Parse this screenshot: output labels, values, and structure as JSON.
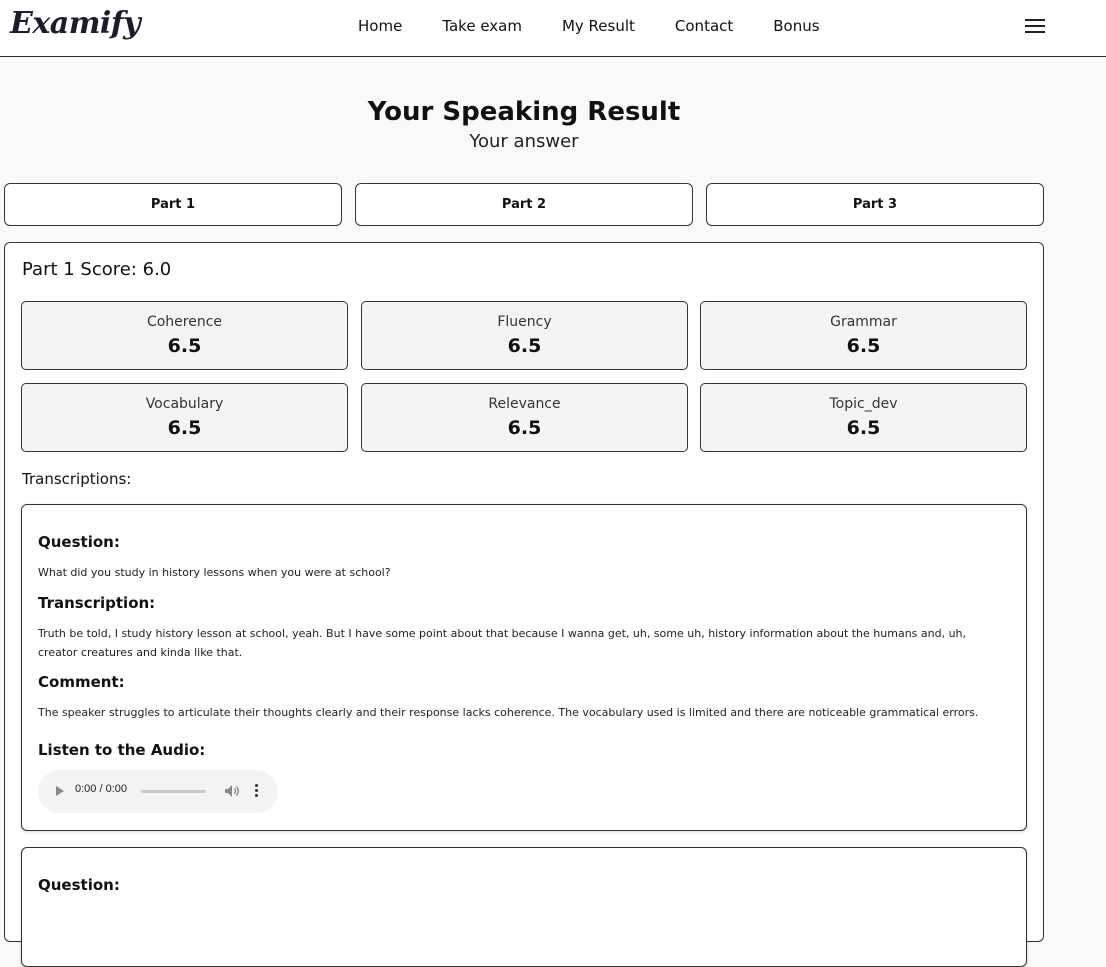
{
  "nav": {
    "logo": "Examify",
    "links": [
      "Home",
      "Take exam",
      "My Result",
      "Contact",
      "Bonus"
    ]
  },
  "header": {
    "title": "Your Speaking Result",
    "subtitle": "Your answer"
  },
  "tabs": [
    "Part 1",
    "Part 2",
    "Part 3"
  ],
  "result": {
    "score_title": "Part 1 Score: 6.0",
    "metrics": [
      {
        "label": "Coherence",
        "value": "6.5"
      },
      {
        "label": "Fluency",
        "value": "6.5"
      },
      {
        "label": "Grammar",
        "value": "6.5"
      },
      {
        "label": "Vocabulary",
        "value": "6.5"
      },
      {
        "label": "Relevance",
        "value": "6.5"
      },
      {
        "label": "Topic_dev",
        "value": "6.5"
      }
    ],
    "transcriptions_heading": "Transcriptions:",
    "items": [
      {
        "question_label": "Question:",
        "question": "What did you study in history lessons when you were at school?",
        "transcription_label": "Transcription:",
        "transcription": "Truth be told, I study history lesson at school, yeah. But I have some point about that because I wanna get, uh, some uh, history information about the humans and, uh, creator creatures and kinda like that.",
        "comment_label": "Comment:",
        "comment": "The speaker struggles to articulate their thoughts clearly and their response lacks coherence. The vocabulary used is limited and there are noticeable grammatical errors.",
        "audio_label": "Listen to the Audio:",
        "audio_time": "0:00 / 0:00",
        "audio_progress": 0
      },
      {
        "question_label": "Question:"
      }
    ]
  }
}
